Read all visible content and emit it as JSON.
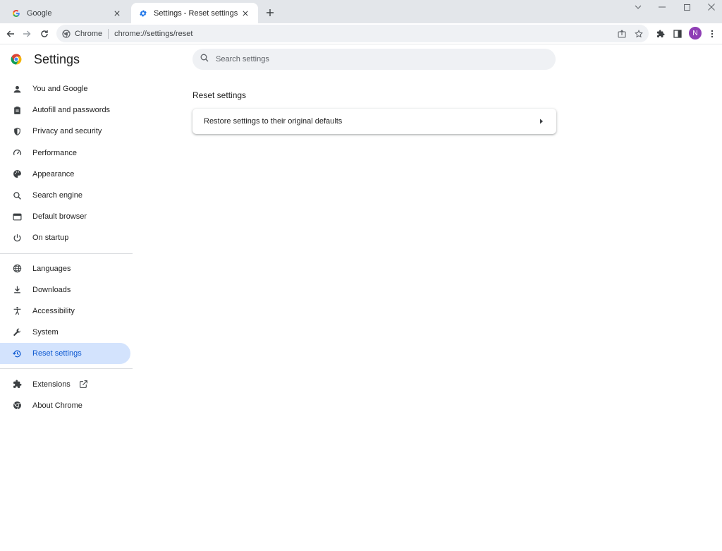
{
  "tabs": [
    {
      "label": "Google",
      "favicon": "google-g-icon",
      "active": false
    },
    {
      "label": "Settings - Reset settings",
      "favicon": "gear-icon",
      "active": true
    }
  ],
  "toolbar": {
    "site_chip": "Chrome",
    "url": "chrome://settings/reset",
    "avatar_letter": "N"
  },
  "settings": {
    "title": "Settings",
    "search_placeholder": "Search settings",
    "nav_group_1": [
      {
        "label": "You and Google",
        "icon": "person-icon"
      },
      {
        "label": "Autofill and passwords",
        "icon": "clipboard-icon"
      },
      {
        "label": "Privacy and security",
        "icon": "shield-icon"
      },
      {
        "label": "Performance",
        "icon": "speedometer-icon"
      },
      {
        "label": "Appearance",
        "icon": "palette-icon"
      },
      {
        "label": "Search engine",
        "icon": "search-icon"
      },
      {
        "label": "Default browser",
        "icon": "browser-window-icon"
      },
      {
        "label": "On startup",
        "icon": "power-icon"
      }
    ],
    "nav_group_2": [
      {
        "label": "Languages",
        "icon": "globe-icon"
      },
      {
        "label": "Downloads",
        "icon": "download-icon"
      },
      {
        "label": "Accessibility",
        "icon": "accessibility-icon"
      },
      {
        "label": "System",
        "icon": "wrench-icon"
      },
      {
        "label": "Reset settings",
        "icon": "history-icon",
        "selected": true
      }
    ],
    "nav_group_3": [
      {
        "label": "Extensions",
        "icon": "puzzle-icon"
      },
      {
        "label": "About Chrome",
        "icon": "chrome-icon"
      }
    ],
    "section_title": "Reset settings",
    "rows": [
      {
        "label": "Restore settings to their original defaults"
      }
    ]
  },
  "colors": {
    "accent": "#0b57d0",
    "selected_bg": "#d3e3fd",
    "avatar": "#8f3fb5"
  }
}
